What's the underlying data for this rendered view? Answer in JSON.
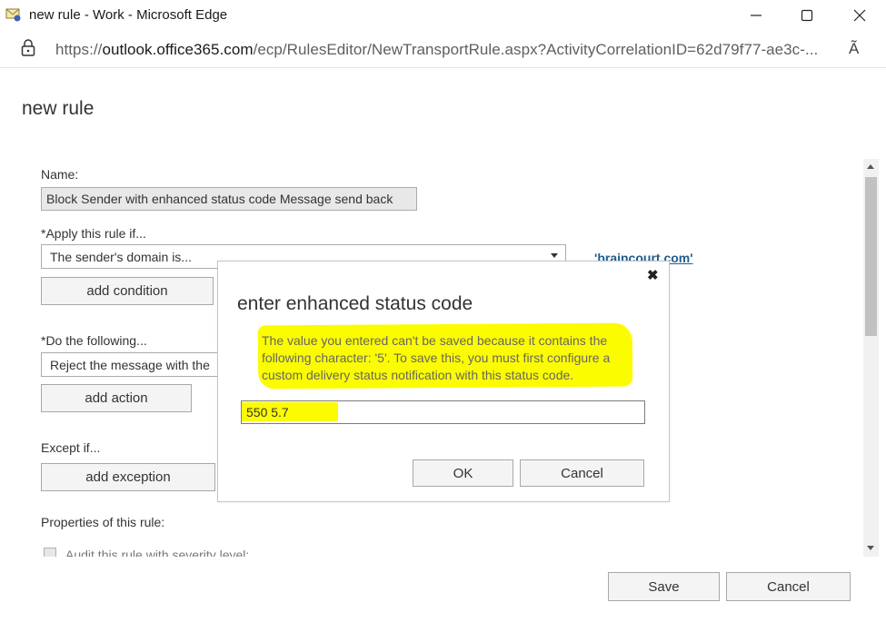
{
  "window": {
    "title": "new rule - Work - Microsoft Edge",
    "controls": [
      "minimize-icon",
      "maximize-icon",
      "close-icon"
    ]
  },
  "address_bar": {
    "url_prefix": "https://",
    "url_host": "outlook.office365.com",
    "url_path": "/ecp/RulesEditor/NewTransportRule.aspx?ActivityCorrelationID=62d79f77-ae3c-...",
    "read_aloud": "Ã"
  },
  "page": {
    "title": "new rule",
    "name_label": "Name:",
    "name_value": "Block Sender with enhanced status code Message send back",
    "apply_label": "*Apply this rule if...",
    "condition_value": "The sender's domain is...",
    "condition_link": "'braincourt.com'",
    "add_condition": "add condition",
    "do_label": "*Do the following...",
    "action_value": "Reject the message with the",
    "add_action": "add action",
    "except_label": "Except if...",
    "add_exception": "add exception",
    "properties_label": "Properties of this rule:",
    "audit_label": "Audit this rule with severity level:",
    "save": "Save",
    "cancel": "Cancel"
  },
  "dialog": {
    "title": "enter enhanced status code",
    "message": "The value you entered can't be saved because it contains the following character: '5'. To save this, you must first configure a custom delivery status notification with this status code.",
    "input_value": "550 5.7",
    "ok": "OK",
    "cancel": "Cancel",
    "highlight_color": "#fcfc00"
  }
}
